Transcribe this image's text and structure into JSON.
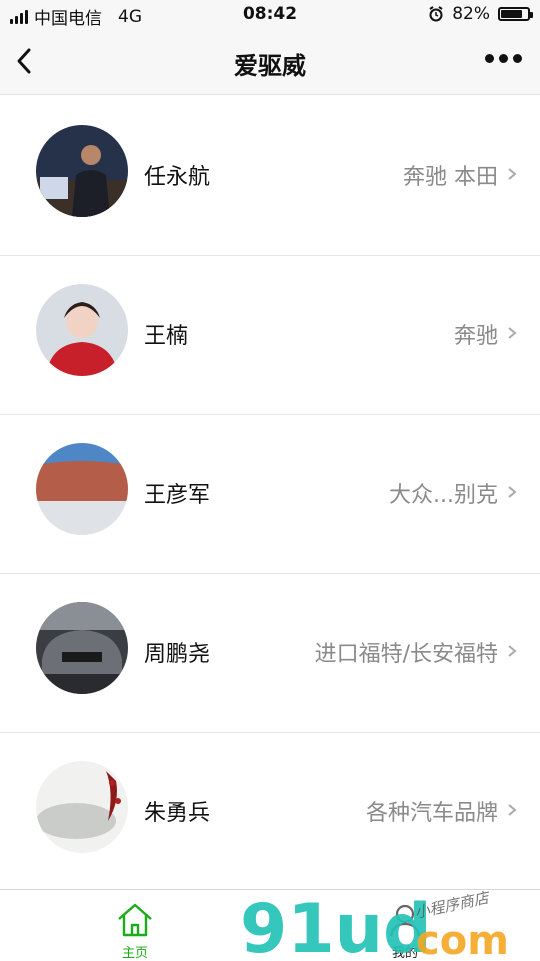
{
  "status_bar": {
    "carrier": "中国电信",
    "network": "4G",
    "time": "08:42",
    "battery": "82%",
    "battery_level": 0.82
  },
  "nav": {
    "title": "爱驱威"
  },
  "dealers": [
    {
      "name": "任永航",
      "brands": "奔驰 本田"
    },
    {
      "name": "王楠",
      "brands": "奔驰"
    },
    {
      "name": "王彦军",
      "brands": "大众...别克"
    },
    {
      "name": "周鹏尧",
      "brands": "进口福特/长安福特"
    },
    {
      "name": "朱勇兵",
      "brands": "各种汽车品牌"
    }
  ],
  "tabbar": {
    "home": "主页",
    "mine": "我的"
  },
  "watermark": {
    "main": "91ud",
    "com": "com",
    "tag": "小程序商店"
  },
  "colors": {
    "active_tab": "#1aad19",
    "secondary_text": "#8a8a8a",
    "watermark_teal": "#21c2b5",
    "watermark_orange": "#f5a623"
  }
}
